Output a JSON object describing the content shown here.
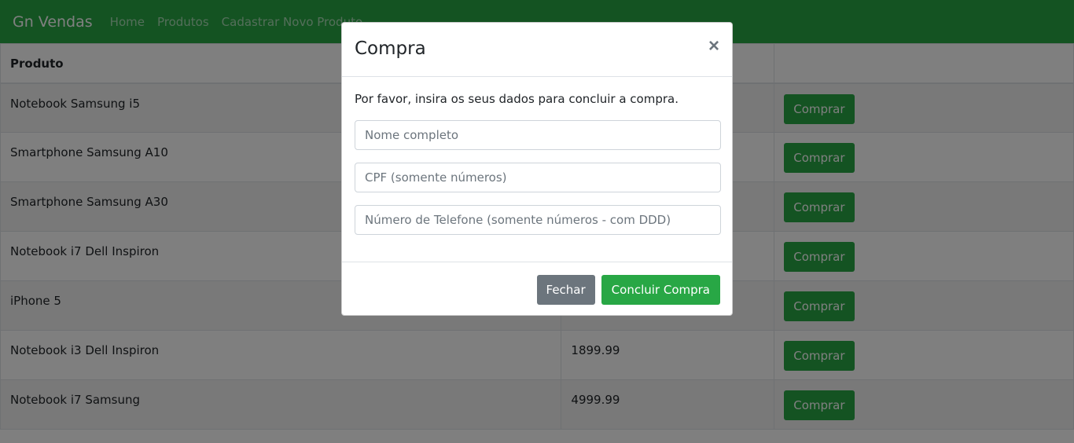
{
  "navbar": {
    "brand": "Gn Vendas",
    "links": [
      "Home",
      "Produtos",
      "Cadastrar Novo Produto"
    ]
  },
  "table": {
    "headers": [
      "Produto",
      "",
      ""
    ],
    "rows": [
      {
        "produto": "Notebook Samsung i5",
        "preco": "",
        "acao": "Comprar"
      },
      {
        "produto": "Smartphone Samsung A10",
        "preco": "",
        "acao": "Comprar"
      },
      {
        "produto": "Smartphone Samsung A30",
        "preco": "",
        "acao": "Comprar"
      },
      {
        "produto": "Notebook i7 Dell Inspiron",
        "preco": "",
        "acao": "Comprar"
      },
      {
        "produto": "iPhone 5",
        "preco": "",
        "acao": "Comprar"
      },
      {
        "produto": "Notebook i3 Dell Inspiron",
        "preco": "1899.99",
        "acao": "Comprar"
      },
      {
        "produto": "Notebook i7 Samsung",
        "preco": "4999.99",
        "acao": "Comprar"
      }
    ]
  },
  "modal": {
    "title": "Compra",
    "close_symbol": "×",
    "text": "Por favor, insira os seus dados para concluir a compra.",
    "fields": [
      {
        "placeholder": "Nome completo",
        "value": ""
      },
      {
        "placeholder": "CPF (somente números)",
        "value": ""
      },
      {
        "placeholder": "Número de Telefone (somente números - com DDD)",
        "value": ""
      }
    ],
    "close_label": "Fechar",
    "submit_label": "Concluir Compra"
  },
  "colors": {
    "brand_green": "#28a745",
    "secondary_gray": "#6c757d"
  }
}
